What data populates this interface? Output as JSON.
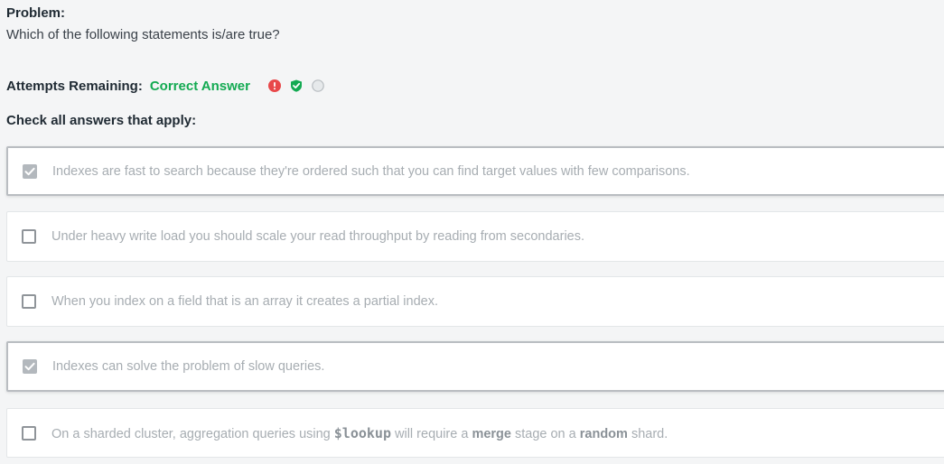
{
  "problem": {
    "label": "Problem:",
    "question": "Which of the following statements is/are true?"
  },
  "attempts": {
    "label": "Attempts Remaining:",
    "status": "Correct Answer",
    "icons": [
      "error-icon",
      "shield-check-icon",
      "empty-circle-icon"
    ],
    "colors": {
      "error": "#e8484a",
      "success": "#13aa52",
      "neutral": "#c5cbcf"
    }
  },
  "instructions": "Check all answers that apply:",
  "options": [
    {
      "text": "Indexes are fast to search because they're ordered such that you can find target values with few comparisons.",
      "checked": true
    },
    {
      "text": "Under heavy write load you should scale your read throughput by reading from secondaries.",
      "checked": false
    },
    {
      "text": "When you index on a field that is an array it creates a partial index.",
      "checked": false
    },
    {
      "text": "Indexes can solve the problem of slow queries.",
      "checked": true
    },
    {
      "checked": false,
      "parts": {
        "a": "On a sharded cluster, aggregation queries using ",
        "b": "$lookup",
        "c": " will require a ",
        "d": "merge",
        "e": " stage on a ",
        "f": "random",
        "g": " shard."
      }
    }
  ]
}
